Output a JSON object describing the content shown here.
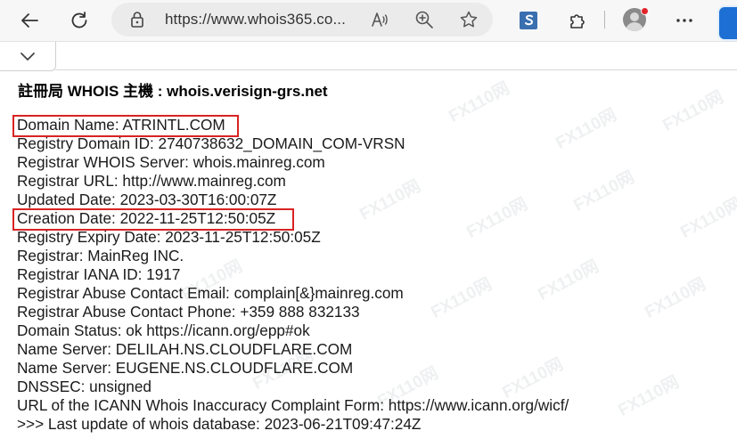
{
  "browser": {
    "url": "https://www.whois365.co...",
    "icons": {
      "back": "back-arrow-icon",
      "refresh": "refresh-icon",
      "lock": "lock-icon",
      "read_aloud": "read-aloud-icon",
      "zoom": "zoom-icon",
      "favorite": "star-icon",
      "extension_s": "s-extension-icon",
      "extensions": "puzzle-icon",
      "profile": "avatar",
      "menu": "more-icon"
    }
  },
  "page": {
    "heading": "註冊局 WHOIS 主機 : whois.verisign-grs.net",
    "lines": [
      "Domain Name: ATRINTL.COM",
      "Registry Domain ID: 2740738632_DOMAIN_COM-VRSN",
      "Registrar WHOIS Server: whois.mainreg.com",
      "Registrar URL: http://www.mainreg.com",
      "Updated Date: 2023-03-30T16:00:07Z",
      "Creation Date: 2022-11-25T12:50:05Z",
      "Registry Expiry Date: 2023-11-25T12:50:05Z",
      "Registrar: MainReg INC.",
      "Registrar IANA ID: 1917",
      "Registrar Abuse Contact Email: complain[&}mainreg.com",
      "Registrar Abuse Contact Phone: +359 888 832133",
      "Domain Status: ok https://icann.org/epp#ok",
      "Name Server: DELILAH.NS.CLOUDFLARE.COM",
      "Name Server: EUGENE.NS.CLOUDFLARE.COM",
      "DNSSEC: unsigned",
      "URL of the ICANN Whois Inaccuracy Complaint Form: https://www.icann.org/wicf/",
      ">>> Last update of whois database: 2023-06-21T09:47:24Z"
    ]
  },
  "watermark": "FX110网",
  "colors": {
    "highlight_border": "#d92323",
    "avatar_badge": "#e2232a"
  }
}
